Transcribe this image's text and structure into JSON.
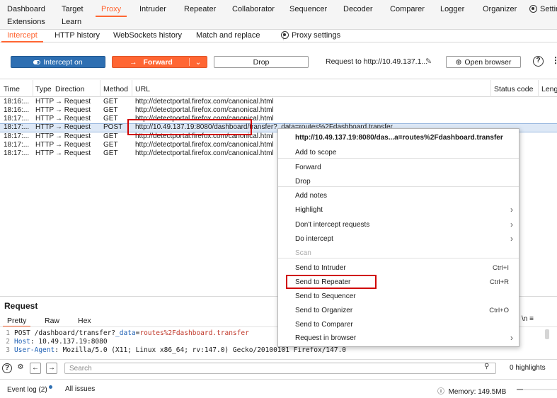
{
  "nav": {
    "row1": [
      "Dashboard",
      "Target",
      "Proxy",
      "Intruder",
      "Repeater",
      "Collaborator",
      "Sequencer",
      "Decoder",
      "Comparer",
      "Logger",
      "Organizer",
      "Settings"
    ],
    "row2": [
      "Extensions",
      "Learn"
    ],
    "active": "Proxy"
  },
  "subtabs": {
    "items": [
      "Intercept",
      "HTTP history",
      "WebSockets history",
      "Match and replace"
    ],
    "proxy_settings": "Proxy settings",
    "active": "Intercept"
  },
  "toolbar": {
    "intercept": "Intercept on",
    "forward": "Forward",
    "forward_arrow": "→",
    "drop": "Drop",
    "request_to": "Request to http://10.49.137.1...",
    "open_browser": "Open browser",
    "help": "?",
    "more": "⋮"
  },
  "table": {
    "headers": [
      "Time",
      "Type",
      "Direction",
      "Method",
      "URL",
      "Status code",
      "Length"
    ],
    "rows": [
      {
        "time": "18:16:...",
        "type": "HTTP",
        "dir": "→  Request",
        "method": "GET",
        "url": "http://detectportal.firefox.com/canonical.html"
      },
      {
        "time": "18:16:...",
        "type": "HTTP",
        "dir": "→  Request",
        "method": "GET",
        "url": "http://detectportal.firefox.com/canonical.html"
      },
      {
        "time": "18:17:...",
        "type": "HTTP",
        "dir": "→  Request",
        "method": "GET",
        "url": "http://detectportal.firefox.com/canonical.html"
      },
      {
        "time": "18:17:...",
        "type": "HTTP",
        "dir": "→  Request",
        "method": "POST",
        "url": "http://10.49.137.19:8080/dashboard/transfer?_data=routes%2Fdashboard.transfer"
      },
      {
        "time": "18:17:...",
        "type": "HTTP",
        "dir": "→  Request",
        "method": "GET",
        "url": "http://detectportal.firefox.com/canonical.html"
      },
      {
        "time": "18:17:...",
        "type": "HTTP",
        "dir": "→  Request",
        "method": "GET",
        "url": "http://detectportal.firefox.com/canonical.html"
      },
      {
        "time": "18:17:...",
        "type": "HTTP",
        "dir": "→  Request",
        "method": "GET",
        "url": "http://detectportal.firefox.com/canonical.html"
      }
    ],
    "selected_index": 3
  },
  "context_menu": {
    "title": "http://10.49.137.19:8080/das...a=routes%2Fdashboard.transfer",
    "items": [
      {
        "label": "Add to scope"
      },
      {
        "label": "Forward"
      },
      {
        "label": "Drop"
      },
      {
        "label": "Add notes"
      },
      {
        "label": "Highlight",
        "submenu": true
      },
      {
        "label": "Don't intercept requests",
        "submenu": true
      },
      {
        "label": "Do intercept",
        "submenu": true
      },
      {
        "label": "Scan",
        "disabled": true
      },
      {
        "label": "Send to Intruder",
        "shortcut": "Ctrl+I"
      },
      {
        "label": "Send to Repeater",
        "shortcut": "Ctrl+R"
      },
      {
        "label": "Send to Sequencer"
      },
      {
        "label": "Send to Organizer",
        "shortcut": "Ctrl+O"
      },
      {
        "label": "Send to Comparer"
      },
      {
        "label": "Request in browser",
        "submenu": true
      }
    ],
    "highlighted": "Send to Repeater"
  },
  "request": {
    "title": "Request",
    "tabs": [
      "Pretty",
      "Raw",
      "Hex"
    ],
    "active_tab": "Pretty",
    "lines": [
      {
        "n": "1",
        "method": "POST",
        "path": "/dashboard/transfer?",
        "param": "_data",
        "eq": "=",
        "value": "routes%2Fdashboard.transfer"
      },
      {
        "n": "2",
        "key": "Host",
        "val": "10.49.137.19:8080"
      },
      {
        "n": "3",
        "key": "User-Agent",
        "val": "Mozilla/5.0 (X11; Linux x86_64; rv:147.0) Gecko/20100101 Firefox/147.0"
      }
    ],
    "right_icons": "\\n  ≡"
  },
  "search": {
    "placeholder": "Search",
    "highlights": "0 highlights"
  },
  "status": {
    "event_log": "Event log (2)",
    "all_issues": "All issues",
    "memory": "Memory: 149.5MB",
    "memory_fraction": 0.15
  },
  "colors": {
    "accent": "#ff6633",
    "intercept_blue": "#2e6fb2",
    "highlight_red": "#d00000"
  }
}
